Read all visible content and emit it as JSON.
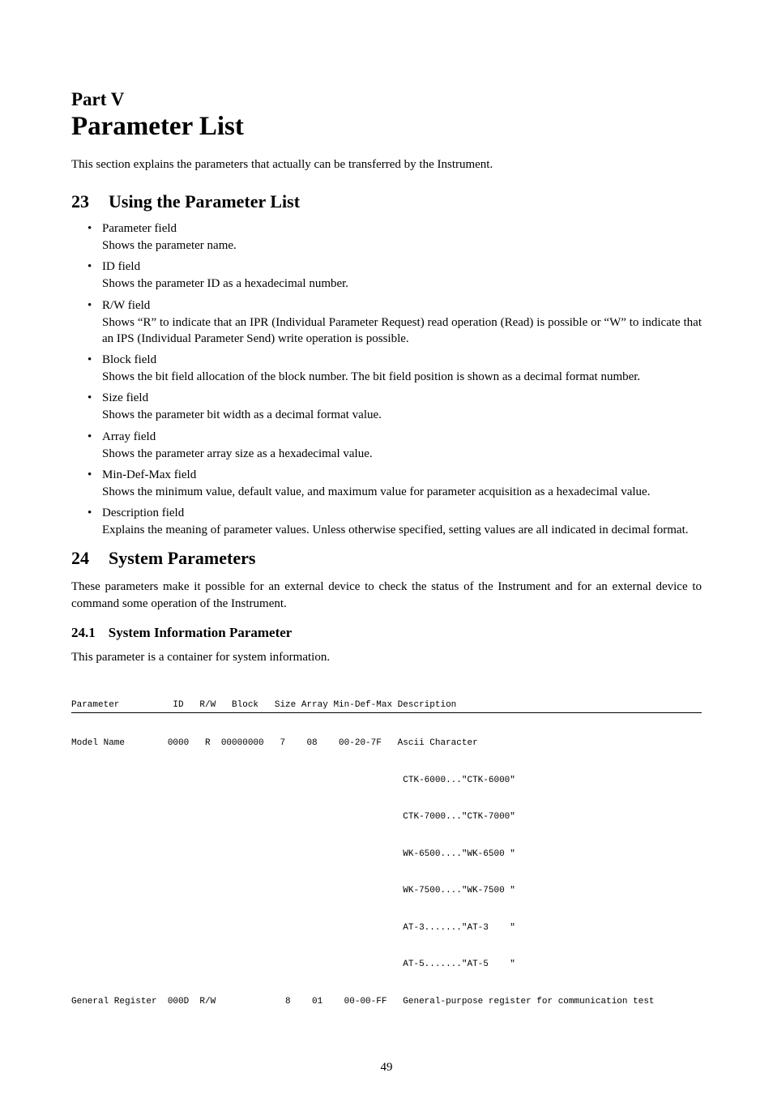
{
  "part_label": "Part V",
  "part_title": "Parameter List",
  "intro": "This section explains the parameters that actually can be transferred by the Instrument.",
  "sec23_num": "23",
  "sec23_title": "Using the Parameter List",
  "fields": [
    {
      "name": "Parameter field",
      "desc": "Shows the parameter name."
    },
    {
      "name": "ID field",
      "desc": "Shows the parameter ID as a hexadecimal number."
    },
    {
      "name": "R/W field",
      "desc": "Shows “R” to indicate that an IPR (Individual Parameter Request) read operation (Read) is possible or “W” to indicate that an IPS (Individual Parameter Send) write operation is possible."
    },
    {
      "name": "Block field",
      "desc": "Shows the bit field allocation of the block number. The bit field position is shown as a decimal format number."
    },
    {
      "name": "Size field",
      "desc": "Shows the parameter bit width as a decimal format value."
    },
    {
      "name": "Array field",
      "desc": "Shows the parameter array size as a hexadecimal value."
    },
    {
      "name": "Min-Def-Max field",
      "desc": "Shows the minimum value, default value, and maximum value for parameter acquisition as a hexadecimal value."
    },
    {
      "name": "Description field",
      "desc": "Explains the meaning of parameter values. Unless otherwise specified, setting values are all indicated in decimal format."
    }
  ],
  "sec24_num": "24",
  "sec24_title": "System Parameters",
  "sec24_intro": "These parameters make it possible for an external device to check the status of the Instrument and for an external device to command some operation of the Instrument.",
  "sec24_1_num": "24.1",
  "sec24_1_title": "System Information Parameter",
  "sec24_1_intro": "This parameter is a container for system information.",
  "table": {
    "header": "Parameter          ID   R/W   Block   Size Array Min-Def-Max Description",
    "rows": [
      "Model Name        0000   R  00000000   7    08    00-20-7F   Ascii Character",
      "                                                              CTK-6000...\"CTK-6000\"",
      "                                                              CTK-7000...\"CTK-7000\"",
      "                                                              WK-6500....\"WK-6500 \"",
      "                                                              WK-7500....\"WK-7500 \"",
      "                                                              AT-3.......\"AT-3    \"",
      "                                                              AT-5.......\"AT-5    \"",
      "General Register  000D  R/W             8    01    00-00-FF   General-purpose register for communication test"
    ]
  },
  "page_number": "49"
}
